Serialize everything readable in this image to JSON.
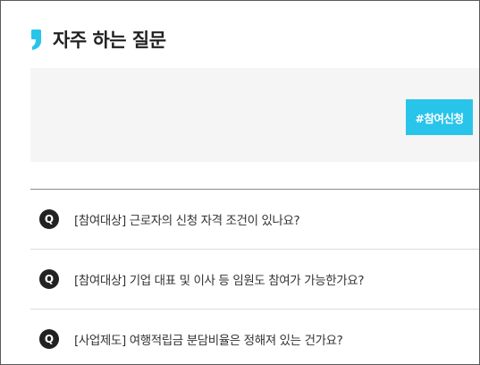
{
  "header": {
    "title": "자주 하는 질문"
  },
  "tags": {
    "button_label": "#참여신청"
  },
  "faq": {
    "badge": "Q",
    "items": [
      {
        "question": "[참여대상] 근로자의 신청 자격 조건이 있나요?"
      },
      {
        "question": "[참여대상] 기업 대표 및 이사 등 임원도 참여가 가능한가요?"
      },
      {
        "question": "[사업제도] 여행적립금 분담비율은 정해져 있는 건가요?"
      }
    ]
  },
  "colors": {
    "accent": "#29c4ea",
    "badge": "#222222"
  },
  "icons": {
    "title": "quote-mark-icon"
  }
}
